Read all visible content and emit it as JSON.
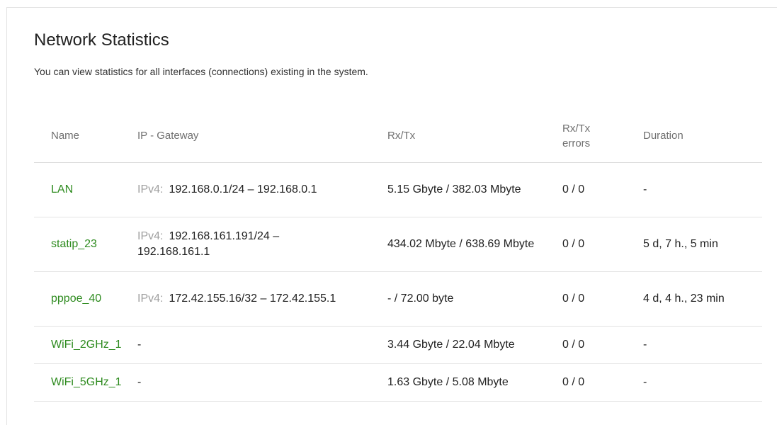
{
  "page": {
    "title": "Network Statistics",
    "description": "You can view statistics for all interfaces (connections) existing in the system."
  },
  "table": {
    "headers": {
      "name": "Name",
      "ip_gateway": "IP - Gateway",
      "rxtx": "Rx/Tx",
      "errors": "Rx/Tx errors",
      "duration": "Duration"
    },
    "rows": [
      {
        "name": "LAN",
        "ip_prefix": "IPv4:",
        "ip": "192.168.0.1/24 – 192.168.0.1",
        "rxtx": "5.15 Gbyte / 382.03 Mbyte",
        "errors": "0 / 0",
        "duration": "-"
      },
      {
        "name": "statip_23",
        "ip_prefix": "IPv4:",
        "ip": "192.168.161.191/24 – 192.168.161.1",
        "rxtx": "434.02 Mbyte / 638.69 Mbyte",
        "errors": "0 / 0",
        "duration": "5 d, 7 h., 5 min"
      },
      {
        "name": "pppoe_40",
        "ip_prefix": "IPv4:",
        "ip": "172.42.155.16/32 – 172.42.155.1",
        "rxtx": "- / 72.00 byte",
        "errors": "0 / 0",
        "duration": "4 d, 4 h., 23 min"
      },
      {
        "name": "WiFi_2GHz_1",
        "ip_prefix": "",
        "ip": "-",
        "rxtx": "3.44 Gbyte / 22.04 Mbyte",
        "errors": "0 / 0",
        "duration": "-"
      },
      {
        "name": "WiFi_5GHz_1",
        "ip_prefix": "",
        "ip": "-",
        "rxtx": "1.63 Gbyte / 5.08 Mbyte",
        "errors": "0 / 0",
        "duration": "-"
      }
    ]
  },
  "colors": {
    "link": "#2e8b1f",
    "header_text": "#6f6f6f",
    "prefix_text": "#a0a0a0",
    "divider": "#e3e3e3"
  }
}
